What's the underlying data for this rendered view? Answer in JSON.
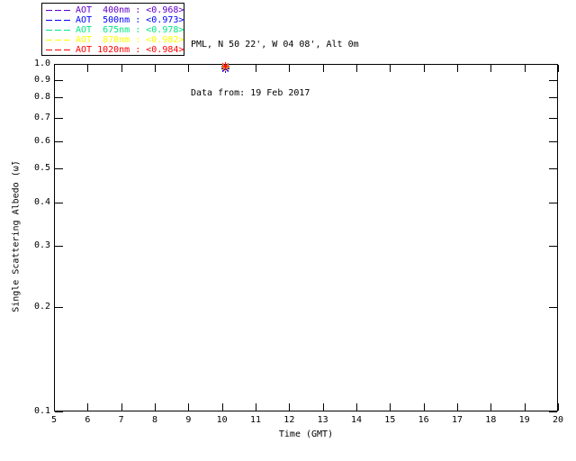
{
  "header": {
    "line1": "PML, N 50 22', W 04 08', Alt 0m",
    "line2": "Data from: 19 Feb 2017"
  },
  "legend": {
    "items": [
      {
        "label": "AOT  400nm : <0.968>",
        "wavelength": "400nm",
        "value": "<0.968>",
        "color": "#6000C8"
      },
      {
        "label": "AOT  500nm : <0.973>",
        "wavelength": "500nm",
        "value": "<0.973>",
        "color": "#0000FF"
      },
      {
        "label": "AOT  675nm : <0.978>",
        "wavelength": "675nm",
        "value": "<0.978>",
        "color": "#00E882"
      },
      {
        "label": "AOT  870nm : <0.982>",
        "wavelength": "870nm",
        "value": "<0.982>",
        "color": "#FFFF00"
      },
      {
        "label": "AOT 1020nm : <0.984>",
        "wavelength": "1020nm",
        "value": "<0.984>",
        "color": "#FF0000"
      }
    ]
  },
  "chart_data": {
    "type": "scatter",
    "title": "PML, N 50 22', W 04 08', Alt 0m",
    "subtitle": "Data from: 19 Feb 2017",
    "xlabel": "Time (GMT)",
    "ylabel": "Single Scattering Albedo (ω̃)",
    "xlim": [
      5,
      20
    ],
    "ylim": [
      0.1,
      1.0
    ],
    "yscale": "log",
    "grid": false,
    "legend_position": "top-left-outside",
    "marker": "asterisk",
    "x_ticks": [
      5,
      6,
      7,
      8,
      9,
      10,
      11,
      12,
      13,
      14,
      15,
      16,
      17,
      18,
      19,
      20
    ],
    "y_ticks": [
      "1.0",
      "0.9",
      "0.8",
      "0.7",
      "0.6",
      "0.5",
      "0.4",
      "0.3",
      "0.2",
      "0.1"
    ],
    "series": [
      {
        "name": "AOT 400nm",
        "mean": "<0.968>",
        "color": "#6000C8",
        "points": [
          {
            "x": 10.1,
            "y": 0.968
          }
        ]
      },
      {
        "name": "AOT 500nm",
        "mean": "<0.973>",
        "color": "#0000FF",
        "points": [
          {
            "x": 10.1,
            "y": 0.973
          }
        ]
      },
      {
        "name": "AOT 675nm",
        "mean": "<0.978>",
        "color": "#00E882",
        "points": [
          {
            "x": 10.1,
            "y": 0.978
          }
        ]
      },
      {
        "name": "AOT 870nm",
        "mean": "<0.982>",
        "color": "#FFFF00",
        "points": [
          {
            "x": 10.1,
            "y": 0.982
          }
        ]
      },
      {
        "name": "AOT 1020nm",
        "mean": "<0.984>",
        "color": "#FF0000",
        "points": [
          {
            "x": 10.1,
            "y": 0.984
          }
        ]
      }
    ]
  }
}
